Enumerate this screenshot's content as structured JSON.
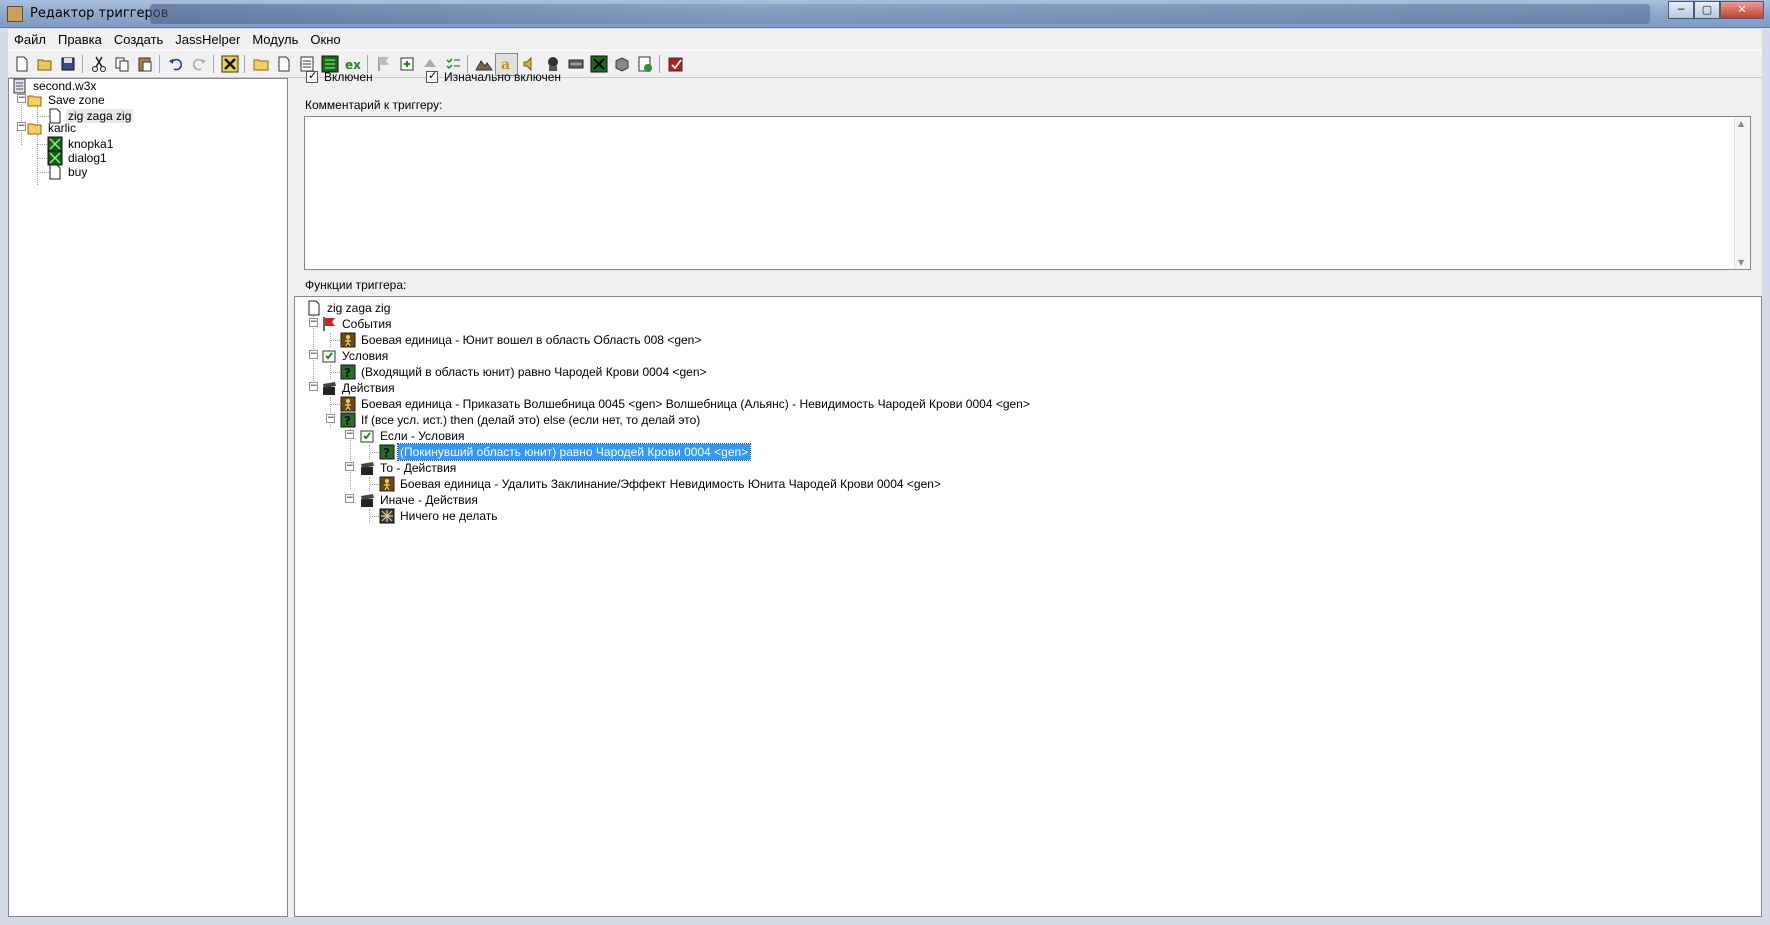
{
  "window": {
    "title": "Редактор триггеров",
    "controls": [
      "─",
      "▢",
      "✕"
    ]
  },
  "menu": [
    "Файл",
    "Правка",
    "Создать",
    "JassHelper",
    "Модуль",
    "Окно"
  ],
  "toolbar": {
    "icons": [
      "new-icon",
      "open-icon",
      "save-icon",
      "cut-icon",
      "copy-icon",
      "paste-icon",
      "undo-icon",
      "redo-icon",
      "jass-icon",
      "new-category-icon",
      "new-trigger-icon",
      "new-comment-icon",
      "new-variable-icon",
      "new-event-icon",
      "new-condition-icon",
      "new-action-icon",
      "disable-icon",
      "checklist-icon",
      "terrain-icon",
      "text-icon",
      "sound-icon",
      "unit-icon",
      "camera-icon",
      "trigger-icon",
      "object-icon",
      "import-icon",
      "test-map-icon"
    ]
  },
  "left_tree": {
    "root": "second.w3x",
    "folders": [
      {
        "name": "Save zone",
        "children": [
          "zig zaga zig"
        ]
      },
      {
        "name": "karlic",
        "children": [
          "knopka1",
          "dialog1",
          "buy"
        ]
      }
    ]
  },
  "trigger": {
    "enabled_label": "Включен",
    "initially_on_label": "Изначально включен",
    "comment_label": "Комментарий к триггеру:",
    "comment_value": "",
    "functions_label": "Функции триггера:"
  },
  "functions": {
    "root": "zig zaga zig",
    "events_label": "События",
    "event_1": "Боевая единица - Юнит вошел в область Область 008 <gen>",
    "conditions_label": "Условия",
    "condition_1": "(Входящий в область юнит) равно Чародей Крови 0004 <gen>",
    "actions_label": "Действия",
    "action_1": "Боевая единица - Приказать Волшебница 0045 <gen> Волшебница (Альянс) - Невидимость Чародей Крови 0004 <gen>",
    "action_2": "If (все усл. ист.) then (делай это) else (если нет, то делай это)",
    "if_conditions": "Если - Условия",
    "if_condition_1": "(Покинувший область юнит) равно Чародей Крови 0004 <gen>",
    "then_actions": "То - Действия",
    "then_action_1": "Боевая единица - Удалить Заклинание/Эффект Невидимость Юнита Чародей Крови 0004 <gen>",
    "else_actions": "Иначе - Действия",
    "else_action_1": "Ничего не делать"
  },
  "colors": {
    "selection": "#3399ff",
    "event_flag": "#d02020",
    "unit_icon_bg": "#6a4a10",
    "condition_icon_bg": "#2a6a2a"
  }
}
